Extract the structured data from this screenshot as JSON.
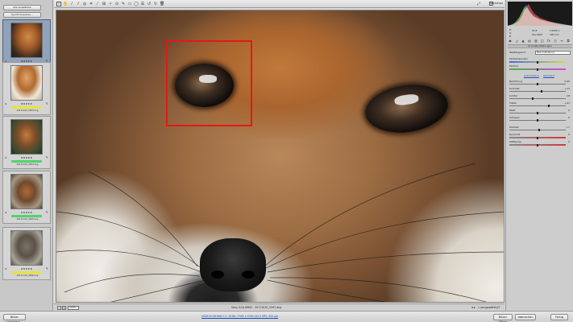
{
  "filmstrip": {
    "select_all_label": "Alle auswählen",
    "sync_label": "Synchronisieren...",
    "thumbnails": [
      {
        "stars": "★★★★★",
        "filename": "20171010_3297.dng",
        "label_color": "#4fd36a",
        "selected": true
      },
      {
        "stars": "★★★★★",
        "filename": "20171010_3283.dng",
        "label_color": "#e8e339",
        "selected": false
      },
      {
        "stars": "★★★★★",
        "filename": "20171010_3284.dng",
        "label_color": "#4fd36a",
        "selected": false
      },
      {
        "stars": "★★★★★",
        "filename": "20171010_3285.dng",
        "label_color": "#4fd36a",
        "selected": false
      },
      {
        "stars": "★★★★★",
        "filename": "20171010_3286.dng",
        "label_color": "#e8e339",
        "selected": false
      }
    ]
  },
  "toolbar": {
    "preview_label": "Vorschau",
    "preview_checked": "✓"
  },
  "statusbar": {
    "zoom_minus": "−",
    "zoom_plus": "+",
    "zoom_value": "100%",
    "file_info": "Sony ILCA-99M2 - 20171010_3297.dng",
    "nav": "◂ ▸",
    "counter": "1 (ausgewählt)/3"
  },
  "histogram": {
    "info_f": "f/2,8",
    "info_shutter": "1/1000 s",
    "info_iso": "ISO 1600",
    "info_focal": "300 mm",
    "info_r": "R:",
    "info_g": "G:",
    "info_b": "B:"
  },
  "panel": {
    "title": "Grundeinstellungen",
    "wb_label": "Weißabgleich:",
    "wb_value": "Wie Aufnahme",
    "link_auto": "Automatisch",
    "link_default": "Standard",
    "sliders": [
      {
        "label": "Farbtemperatur",
        "value": "",
        "pos": 0.5
      },
      {
        "label": "Farbton",
        "value": "",
        "pos": 0.5
      },
      {
        "label": "Belichtung",
        "value": "0,00",
        "pos": 0.5
      },
      {
        "label": "Kontrast",
        "value": "+13",
        "pos": 0.57
      },
      {
        "label": "Lichter",
        "value": "-18",
        "pos": 0.41
      },
      {
        "label": "Tiefen",
        "value": "+41",
        "pos": 0.7
      },
      {
        "label": "Weiß",
        "value": "0",
        "pos": 0.5
      },
      {
        "label": "Schwarz",
        "value": "0",
        "pos": 0.5
      },
      {
        "label": "Klarheit",
        "value": "+7",
        "pos": 0.53
      },
      {
        "label": "Dynamik",
        "value": "0",
        "pos": 0.5
      },
      {
        "label": "Sättigung",
        "value": "0",
        "pos": 0.5
      }
    ]
  },
  "bottombar": {
    "save_label": "Bilder speichern...",
    "workflow": "sRGB IEC61966-2.1; 16 Bit; 7952 x 5304 (42,2 MP); 300 ppi",
    "open_label": "Bilder öffnen",
    "cancel_label": "Abbrechen",
    "done_label": "Fertig"
  },
  "colors": {
    "focus_box": "#e01919",
    "label_green": "#4fd36a",
    "label_yellow": "#e8e339"
  }
}
